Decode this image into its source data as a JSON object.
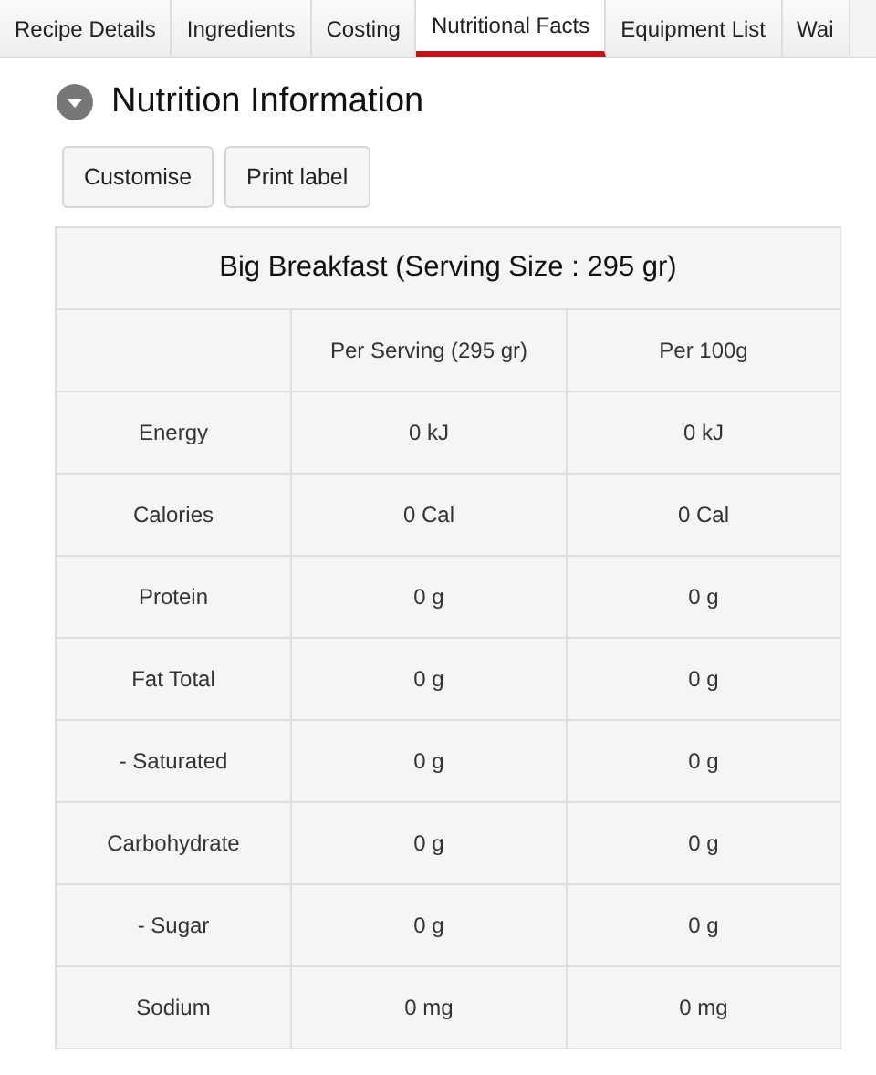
{
  "tabs": [
    {
      "label": "Recipe Details",
      "selected": false
    },
    {
      "label": "Ingredients",
      "selected": false
    },
    {
      "label": "Costing",
      "selected": false
    },
    {
      "label": "Nutritional Facts",
      "selected": true
    },
    {
      "label": "Equipment List",
      "selected": false
    },
    {
      "label": "Wai",
      "selected": false
    }
  ],
  "section": {
    "title": "Nutrition Information",
    "expanded": true
  },
  "buttons": [
    "Customise",
    "Print label"
  ],
  "table": {
    "title": "Big Breakfast (Serving Size : 295 gr)",
    "columns": [
      "Per Serving (295 gr)",
      "Per 100g"
    ],
    "rows": [
      {
        "label": "Energy",
        "values": [
          "0 kJ",
          "0 kJ"
        ]
      },
      {
        "label": "Calories",
        "values": [
          "0 Cal",
          "0 Cal"
        ]
      },
      {
        "label": "Protein",
        "values": [
          "0 g",
          "0 g"
        ]
      },
      {
        "label": "Fat Total",
        "values": [
          "0 g",
          "0 g"
        ]
      },
      {
        "label": "- Saturated",
        "values": [
          "0 g",
          "0 g"
        ]
      },
      {
        "label": "Carbohydrate",
        "values": [
          "0 g",
          "0 g"
        ]
      },
      {
        "label": "- Sugar",
        "values": [
          "0 g",
          "0 g"
        ]
      },
      {
        "label": "Sodium",
        "values": [
          "0 mg",
          "0 mg"
        ]
      }
    ]
  }
}
